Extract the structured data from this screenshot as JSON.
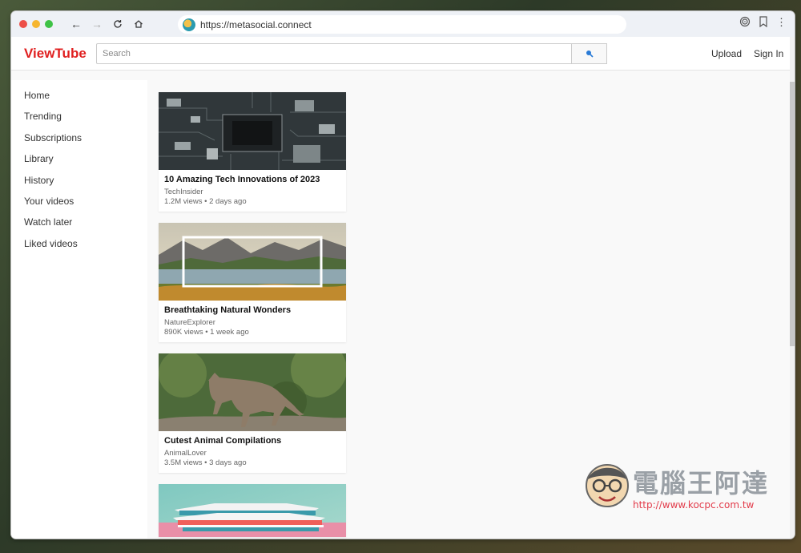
{
  "browser": {
    "url": "https://metasocial.connect",
    "traffic_colors": [
      "#ed4f48",
      "#f6b630",
      "#3ec246"
    ]
  },
  "header": {
    "logo": "ViewTube",
    "search_placeholder": "Search",
    "upload_label": "Upload",
    "signin_label": "Sign In",
    "brand_color": "#e02020"
  },
  "sidebar": {
    "items": [
      {
        "label": "Home"
      },
      {
        "label": "Trending"
      },
      {
        "label": "Subscriptions"
      },
      {
        "label": "Library"
      },
      {
        "label": "History"
      },
      {
        "label": "Your videos"
      },
      {
        "label": "Watch later"
      },
      {
        "label": "Liked videos"
      }
    ]
  },
  "videos": [
    {
      "title": "10 Amazing Tech Innovations of 2023",
      "channel": "TechInsider",
      "meta": "1.2M views • 2 days ago"
    },
    {
      "title": "Breathtaking Natural Wonders",
      "channel": "NatureExplorer",
      "meta": "890K views • 1 week ago"
    },
    {
      "title": "Cutest Animal Compilations",
      "channel": "AnimalLover",
      "meta": "3.5M views • 3 days ago"
    }
  ],
  "watermark": {
    "text": "電腦王阿達",
    "url": "http://www.kocpc.com.tw"
  }
}
